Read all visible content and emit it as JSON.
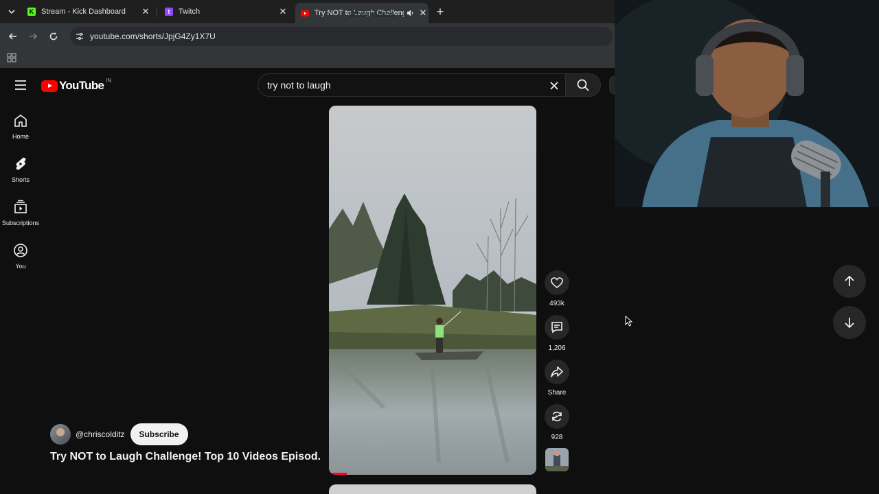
{
  "browser": {
    "tabs": [
      {
        "title": "Stream - Kick Dashboard",
        "favicon": "kick-icon",
        "active": false
      },
      {
        "title": "Twitch",
        "favicon": "twitch-icon",
        "active": false
      },
      {
        "title": "Try NOT to Laugh Challenge",
        "favicon": "youtube-icon",
        "active": true
      }
    ],
    "url": "youtube.com/shorts/JpjG4Zy1X7U"
  },
  "overlay": {
    "watermark": "streamlabs"
  },
  "youtube": {
    "logo_text": "YouTube",
    "country_code": "IN",
    "search": {
      "query": "try not to laugh"
    },
    "guide": [
      {
        "label": "Home",
        "icon": "home-icon"
      },
      {
        "label": "Shorts",
        "icon": "shorts-icon"
      },
      {
        "label": "Subscriptions",
        "icon": "subscriptions-icon"
      },
      {
        "label": "You",
        "icon": "you-icon"
      }
    ],
    "short": {
      "channel": "@chriscolditz",
      "subscribe_label": "Subscribe",
      "title": "Try NOT to Laugh Challenge! Top 10 Videos Episod..."
    },
    "actions": {
      "likes": "493k",
      "comments": "1,206",
      "share": "Share",
      "remix": "928"
    }
  },
  "colors": {
    "accent": "#ff0000",
    "background": "#0f0f0f",
    "button_bg": "#272727"
  }
}
